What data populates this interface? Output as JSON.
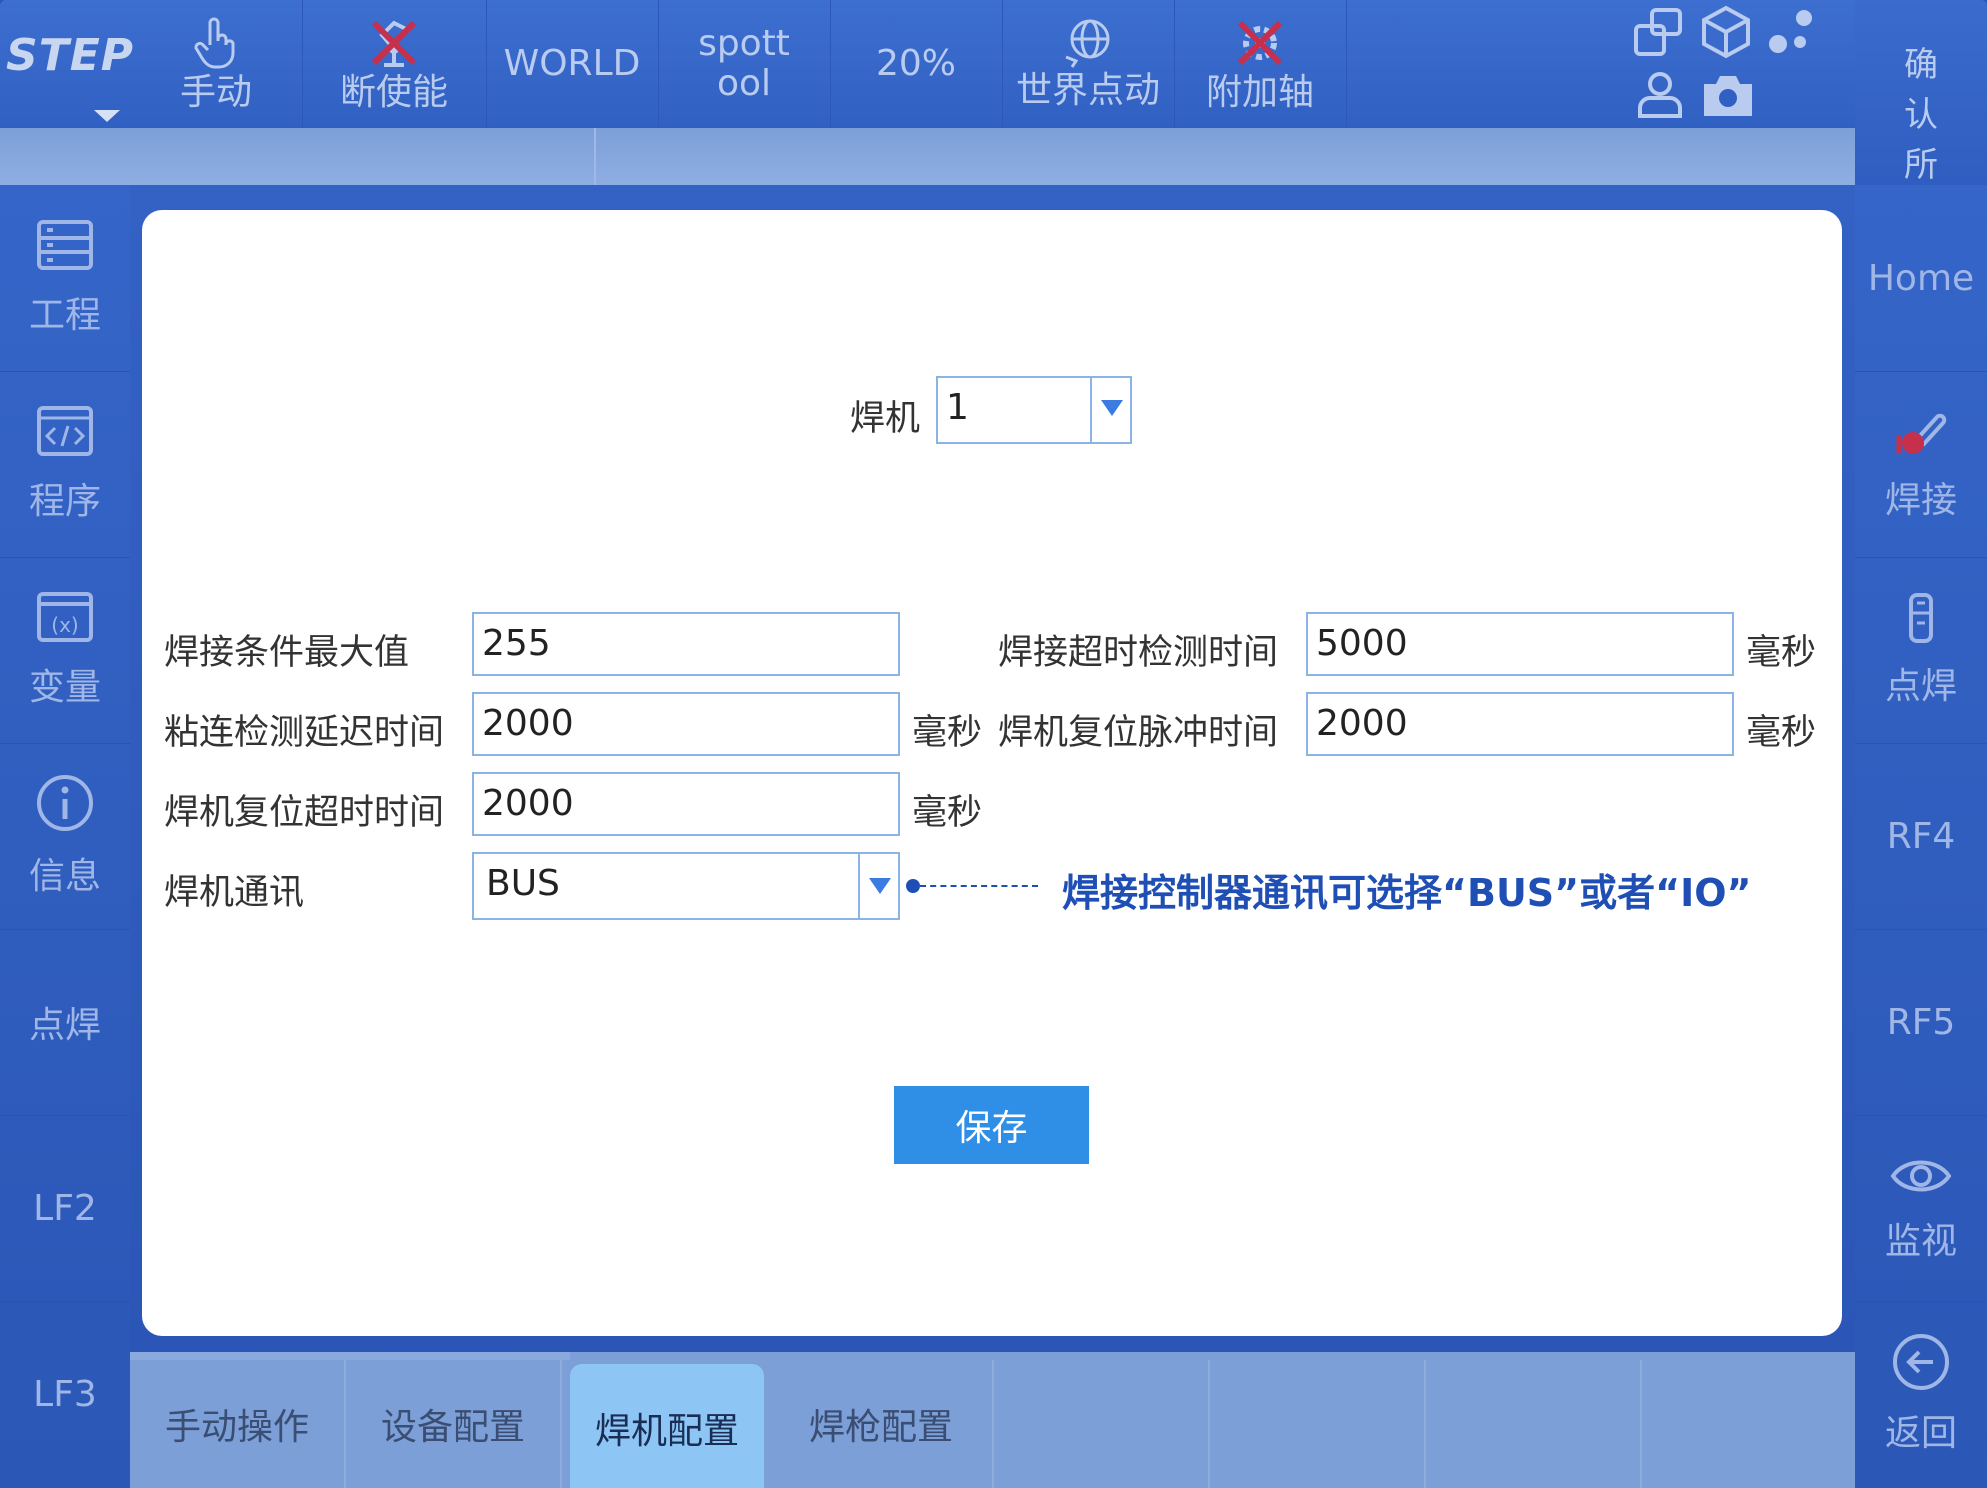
{
  "topbar": {
    "logo": "STEP",
    "buttons": [
      {
        "label": "手动",
        "icon": "hand-pointer-icon"
      },
      {
        "label": "断使能",
        "icon": "robot-disabled-icon"
      },
      {
        "label": "WORLD"
      },
      {
        "label": "spott\nool"
      },
      {
        "label": "20%"
      },
      {
        "label": "世界点动",
        "icon": "globe-jog-icon"
      },
      {
        "label": "附加轴",
        "icon": "gear-disabled-icon"
      }
    ],
    "confirm_all": "确认所有"
  },
  "left_sidebar": {
    "items": [
      {
        "label": "工程",
        "icon": "project-icon"
      },
      {
        "label": "程序",
        "icon": "code-icon"
      },
      {
        "label": "变量",
        "icon": "variable-icon"
      },
      {
        "label": "信息",
        "icon": "info-icon"
      },
      {
        "label": "点焊"
      },
      {
        "label": "LF2"
      },
      {
        "label": "LF3"
      }
    ]
  },
  "right_sidebar": {
    "items": [
      {
        "label": "Home"
      },
      {
        "label": "焊接",
        "icon": "welding-torch-icon"
      },
      {
        "label": "点焊",
        "icon": "spot-weld-gun-icon"
      },
      {
        "label": "RF4"
      },
      {
        "label": "RF5"
      },
      {
        "label": "监视",
        "icon": "eye-icon"
      },
      {
        "label": "返回",
        "icon": "back-arrow-icon"
      }
    ]
  },
  "form": {
    "welder_label": "焊机",
    "welder_value": "1",
    "max_condition_label": "焊接条件最大值",
    "max_condition_value": "255",
    "stick_delay_label": "粘连检测延迟时间",
    "stick_delay_value": "2000",
    "stick_delay_unit": "毫秒",
    "reset_timeout_label": "焊机复位超时时间",
    "reset_timeout_value": "2000",
    "reset_timeout_unit": "毫秒",
    "comm_label": "焊机通讯",
    "comm_value": "BUS",
    "weld_timeout_label": "焊接超时检测时间",
    "weld_timeout_value": "5000",
    "weld_timeout_unit": "毫秒",
    "reset_pulse_label": "焊机复位脉冲时间",
    "reset_pulse_value": "2000",
    "reset_pulse_unit": "毫秒",
    "save_label": "保存"
  },
  "annotation": {
    "text": "焊接控制器通讯可选择“BUS”或者“IO”",
    "color": "#1f4fb5"
  },
  "tabs": [
    {
      "label": "手动操作",
      "active": false
    },
    {
      "label": "设备配置",
      "active": false
    },
    {
      "label": "焊机配置",
      "active": true
    },
    {
      "label": "焊枪配置",
      "active": false
    }
  ],
  "colors": {
    "accent": "#2f8fe6",
    "field_border": "#8bb3e6",
    "frame": "#2a56b8"
  }
}
